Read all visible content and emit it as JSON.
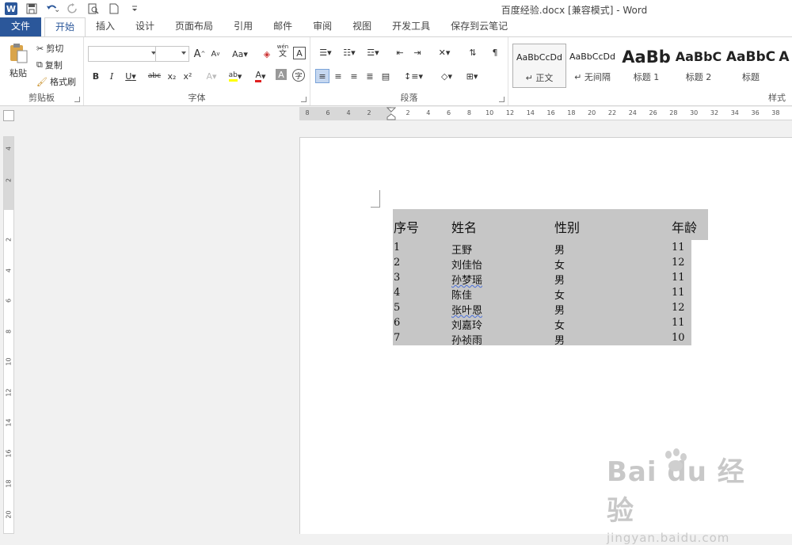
{
  "window": {
    "title": "百度经验.docx [兼容模式] - Word"
  },
  "qat_icons": [
    "word-logo",
    "save-icon",
    "undo-icon",
    "redo-icon",
    "print-preview-icon",
    "new-document-icon",
    "customize-qat-icon"
  ],
  "qat_logo_text": "W",
  "tabs": [
    "文件",
    "开始",
    "插入",
    "设计",
    "页面布局",
    "引用",
    "邮件",
    "审阅",
    "视图",
    "开发工具",
    "保存到云笔记"
  ],
  "active_tab": "开始",
  "clipboard": {
    "paste": "粘贴",
    "cut": "剪切",
    "copy": "复制",
    "format_painter": "格式刷",
    "label": "剪贴板"
  },
  "font": {
    "family_value": "",
    "size_value": "",
    "grow": "A",
    "shrink": "A",
    "case": "Aa",
    "pinyin": "wén",
    "pinyin_char": "文",
    "border_char": "A",
    "bold": "B",
    "italic": "I",
    "underline": "U",
    "strike": "abc",
    "subscript": "x₂",
    "superscript": "x²",
    "effects": "A",
    "highlight": "ab",
    "font_color": "A",
    "shading_char": "A",
    "enclose_char": "字",
    "label": "字体"
  },
  "paragraph": {
    "label": "段落"
  },
  "styles": {
    "label": "样式",
    "items": [
      {
        "sample": "AaBbCcDd",
        "name": "↵ 正文"
      },
      {
        "sample": "AaBbCcDd",
        "name": "↵ 无间隔"
      },
      {
        "sample": "AaBb",
        "name": "标题 1"
      },
      {
        "sample": "AaBbC",
        "name": "标题 2"
      },
      {
        "sample": "AaBbC",
        "name": "标题"
      },
      {
        "sample": "A",
        "name": ""
      }
    ]
  },
  "hruler_ticks": [
    "8",
    "6",
    "4",
    "2",
    "2",
    "4",
    "6",
    "8",
    "10",
    "12",
    "14",
    "16",
    "18",
    "20",
    "22",
    "24",
    "26",
    "28",
    "30",
    "32",
    "34",
    "36",
    "38"
  ],
  "vruler_ticks": [
    "4",
    "2",
    "2",
    "4",
    "6",
    "8",
    "10",
    "12",
    "14",
    "16",
    "18",
    "20"
  ],
  "table": {
    "headers": [
      "序号",
      "姓名",
      "性别",
      "年龄"
    ],
    "rows": [
      [
        "1",
        "王野",
        "男",
        "11"
      ],
      [
        "2",
        "刘佳怡",
        "女",
        "12"
      ],
      [
        "3",
        "孙梦瑶",
        "男",
        "11"
      ],
      [
        "4",
        "陈佳",
        "女",
        "11"
      ],
      [
        "5",
        "张叶恩",
        "男",
        "12"
      ],
      [
        "6",
        "刘嘉玲",
        "女",
        "11"
      ],
      [
        "7",
        "孙祯雨",
        "男",
        "10"
      ]
    ],
    "spellcheck_rows": [
      2,
      4
    ]
  },
  "watermark": {
    "logo": "Bai du 经验",
    "url": "jingyan.baidu.com"
  },
  "colors": {
    "accent": "#2b579a",
    "table_fill": "#c6c6c6",
    "highlight": "#ffff00",
    "font_color": "#e02020"
  }
}
